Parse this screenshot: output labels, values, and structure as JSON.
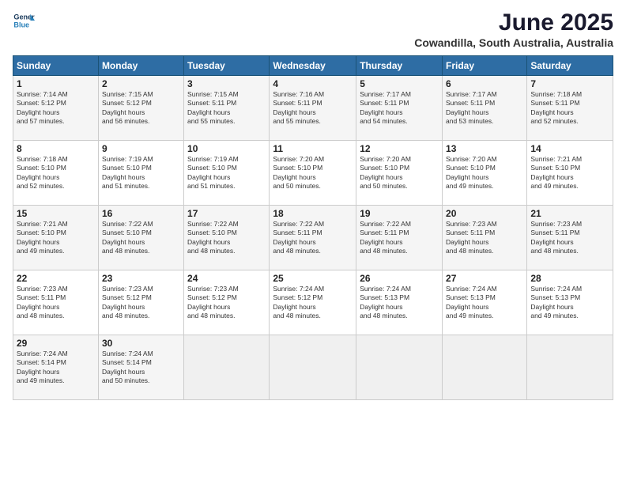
{
  "header": {
    "logo_line1": "General",
    "logo_line2": "Blue",
    "title": "June 2025",
    "subtitle": "Cowandilla, South Australia, Australia"
  },
  "calendar": {
    "days_of_week": [
      "Sunday",
      "Monday",
      "Tuesday",
      "Wednesday",
      "Thursday",
      "Friday",
      "Saturday"
    ],
    "weeks": [
      [
        null,
        {
          "day": 2,
          "sunrise": "7:15 AM",
          "sunset": "5:12 PM",
          "daylight": "9 hours and 56 minutes."
        },
        {
          "day": 3,
          "sunrise": "7:15 AM",
          "sunset": "5:11 PM",
          "daylight": "9 hours and 55 minutes."
        },
        {
          "day": 4,
          "sunrise": "7:16 AM",
          "sunset": "5:11 PM",
          "daylight": "9 hours and 55 minutes."
        },
        {
          "day": 5,
          "sunrise": "7:17 AM",
          "sunset": "5:11 PM",
          "daylight": "9 hours and 54 minutes."
        },
        {
          "day": 6,
          "sunrise": "7:17 AM",
          "sunset": "5:11 PM",
          "daylight": "9 hours and 53 minutes."
        },
        {
          "day": 7,
          "sunrise": "7:18 AM",
          "sunset": "5:11 PM",
          "daylight": "9 hours and 52 minutes."
        }
      ],
      [
        {
          "day": 1,
          "sunrise": "7:14 AM",
          "sunset": "5:12 PM",
          "daylight": "9 hours and 57 minutes.",
          "week1sunday": true
        },
        {
          "day": 8,
          "sunrise": "7:18 AM",
          "sunset": "5:10 PM",
          "daylight": "9 hours and 52 minutes."
        },
        {
          "day": 9,
          "sunrise": "7:19 AM",
          "sunset": "5:10 PM",
          "daylight": "9 hours and 51 minutes."
        },
        {
          "day": 10,
          "sunrise": "7:19 AM",
          "sunset": "5:10 PM",
          "daylight": "9 hours and 51 minutes."
        },
        {
          "day": 11,
          "sunrise": "7:20 AM",
          "sunset": "5:10 PM",
          "daylight": "9 hours and 50 minutes."
        },
        {
          "day": 12,
          "sunrise": "7:20 AM",
          "sunset": "5:10 PM",
          "daylight": "9 hours and 50 minutes."
        },
        {
          "day": 13,
          "sunrise": "7:20 AM",
          "sunset": "5:10 PM",
          "daylight": "9 hours and 49 minutes."
        },
        {
          "day": 14,
          "sunrise": "7:21 AM",
          "sunset": "5:10 PM",
          "daylight": "9 hours and 49 minutes."
        }
      ],
      [
        {
          "day": 15,
          "sunrise": "7:21 AM",
          "sunset": "5:10 PM",
          "daylight": "9 hours and 49 minutes."
        },
        {
          "day": 16,
          "sunrise": "7:22 AM",
          "sunset": "5:10 PM",
          "daylight": "9 hours and 48 minutes."
        },
        {
          "day": 17,
          "sunrise": "7:22 AM",
          "sunset": "5:10 PM",
          "daylight": "9 hours and 48 minutes."
        },
        {
          "day": 18,
          "sunrise": "7:22 AM",
          "sunset": "5:11 PM",
          "daylight": "9 hours and 48 minutes."
        },
        {
          "day": 19,
          "sunrise": "7:22 AM",
          "sunset": "5:11 PM",
          "daylight": "9 hours and 48 minutes."
        },
        {
          "day": 20,
          "sunrise": "7:23 AM",
          "sunset": "5:11 PM",
          "daylight": "9 hours and 48 minutes."
        },
        {
          "day": 21,
          "sunrise": "7:23 AM",
          "sunset": "5:11 PM",
          "daylight": "9 hours and 48 minutes."
        }
      ],
      [
        {
          "day": 22,
          "sunrise": "7:23 AM",
          "sunset": "5:11 PM",
          "daylight": "9 hours and 48 minutes."
        },
        {
          "day": 23,
          "sunrise": "7:23 AM",
          "sunset": "5:12 PM",
          "daylight": "9 hours and 48 minutes."
        },
        {
          "day": 24,
          "sunrise": "7:23 AM",
          "sunset": "5:12 PM",
          "daylight": "9 hours and 48 minutes."
        },
        {
          "day": 25,
          "sunrise": "7:24 AM",
          "sunset": "5:12 PM",
          "daylight": "9 hours and 48 minutes."
        },
        {
          "day": 26,
          "sunrise": "7:24 AM",
          "sunset": "5:13 PM",
          "daylight": "9 hours and 48 minutes."
        },
        {
          "day": 27,
          "sunrise": "7:24 AM",
          "sunset": "5:13 PM",
          "daylight": "9 hours and 49 minutes."
        },
        {
          "day": 28,
          "sunrise": "7:24 AM",
          "sunset": "5:13 PM",
          "daylight": "9 hours and 49 minutes."
        }
      ],
      [
        {
          "day": 29,
          "sunrise": "7:24 AM",
          "sunset": "5:14 PM",
          "daylight": "9 hours and 49 minutes."
        },
        {
          "day": 30,
          "sunrise": "7:24 AM",
          "sunset": "5:14 PM",
          "daylight": "9 hours and 50 minutes."
        },
        null,
        null,
        null,
        null,
        null
      ]
    ]
  }
}
